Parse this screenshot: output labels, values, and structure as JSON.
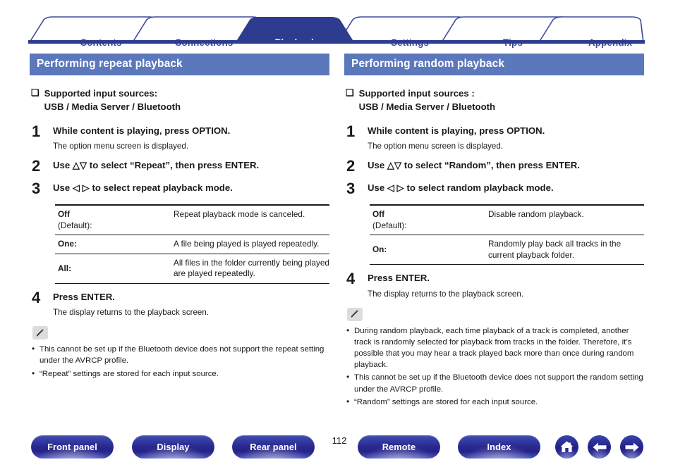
{
  "tabs": [
    {
      "label": "Contents",
      "active": false
    },
    {
      "label": "Connections",
      "active": false
    },
    {
      "label": "Playback",
      "active": true
    },
    {
      "label": "Settings",
      "active": false
    },
    {
      "label": "Tips",
      "active": false
    },
    {
      "label": "Appendix",
      "active": false
    }
  ],
  "colors": {
    "tab_active_bg": "#2e3c8f",
    "tab_text": "#3b4a9e",
    "section_header_bg": "#5b78bc",
    "rule": "#2e3c8f",
    "pill": "#2b2a93"
  },
  "left": {
    "header": "Performing repeat playback",
    "supported_label": "Supported input sources:",
    "supported_value": "USB / Media Server / Bluetooth",
    "square_icon": "❑",
    "steps": [
      {
        "num": "1",
        "title": "While content is playing, press OPTION.",
        "sub": "The option menu screen is displayed."
      },
      {
        "num": "2",
        "title": "Use △▽ to select “Repeat”, then press ENTER.",
        "sub": ""
      },
      {
        "num": "3",
        "title": "Use ◁ ▷ to select repeat playback mode.",
        "sub": ""
      },
      {
        "num": "4",
        "title": "Press ENTER.",
        "sub": "The display returns to the playback screen."
      }
    ],
    "table": {
      "rows": [
        {
          "key": "Off",
          "key_sub": "(Default):",
          "value": "Repeat playback mode is canceled."
        },
        {
          "key": "One:",
          "key_sub": "",
          "value": "A file being played is played repeatedly."
        },
        {
          "key": "All:",
          "key_sub": "",
          "value": "All files in the folder currently being played are played repeatedly."
        }
      ]
    },
    "note_icon": "pencil-icon",
    "notes": [
      "This cannot be set up if the Bluetooth device does not support the repeat setting under the AVRCP profile.",
      "“Repeat” settings are stored for each input source."
    ]
  },
  "right": {
    "header": "Performing random playback",
    "supported_label": "Supported input sources :",
    "supported_value": "USB / Media Server / Bluetooth",
    "square_icon": "❑",
    "steps": [
      {
        "num": "1",
        "title": "While content is playing, press OPTION.",
        "sub": "The option menu screen is displayed."
      },
      {
        "num": "2",
        "title": "Use △▽ to select “Random”, then press ENTER.",
        "sub": ""
      },
      {
        "num": "3",
        "title": "Use ◁ ▷ to select random playback mode.",
        "sub": ""
      },
      {
        "num": "4",
        "title": "Press ENTER.",
        "sub": "The display returns to the playback screen."
      }
    ],
    "table": {
      "rows": [
        {
          "key": "Off",
          "key_sub": "(Default):",
          "value": "Disable random playback."
        },
        {
          "key": "On:",
          "key_sub": "",
          "value": "Randomly play back all tracks in the current playback folder."
        }
      ]
    },
    "note_icon": "pencil-icon",
    "notes": [
      "During random playback, each time playback of a track is completed, another track is randomly selected for playback from tracks in the folder. Therefore, it’s possible that you may hear a track played back more than once during random playback.",
      "This cannot be set up if the Bluetooth device does not support the random setting under the AVRCP profile.",
      "“Random” settings are stored for each input source."
    ]
  },
  "footer": {
    "buttons": [
      {
        "label": "Front panel",
        "id": "pill-front"
      },
      {
        "label": "Display",
        "id": "pill-disp"
      },
      {
        "label": "Rear panel",
        "id": "pill-rear"
      },
      {
        "label": "Remote",
        "id": "pill-remote"
      },
      {
        "label": "Index",
        "id": "pill-index"
      }
    ],
    "page_number": "112",
    "icons": [
      {
        "name": "home-icon",
        "id": "circ-home"
      },
      {
        "name": "arrow-left-icon",
        "id": "circ-back"
      },
      {
        "name": "arrow-right-icon",
        "id": "circ-next"
      }
    ]
  }
}
